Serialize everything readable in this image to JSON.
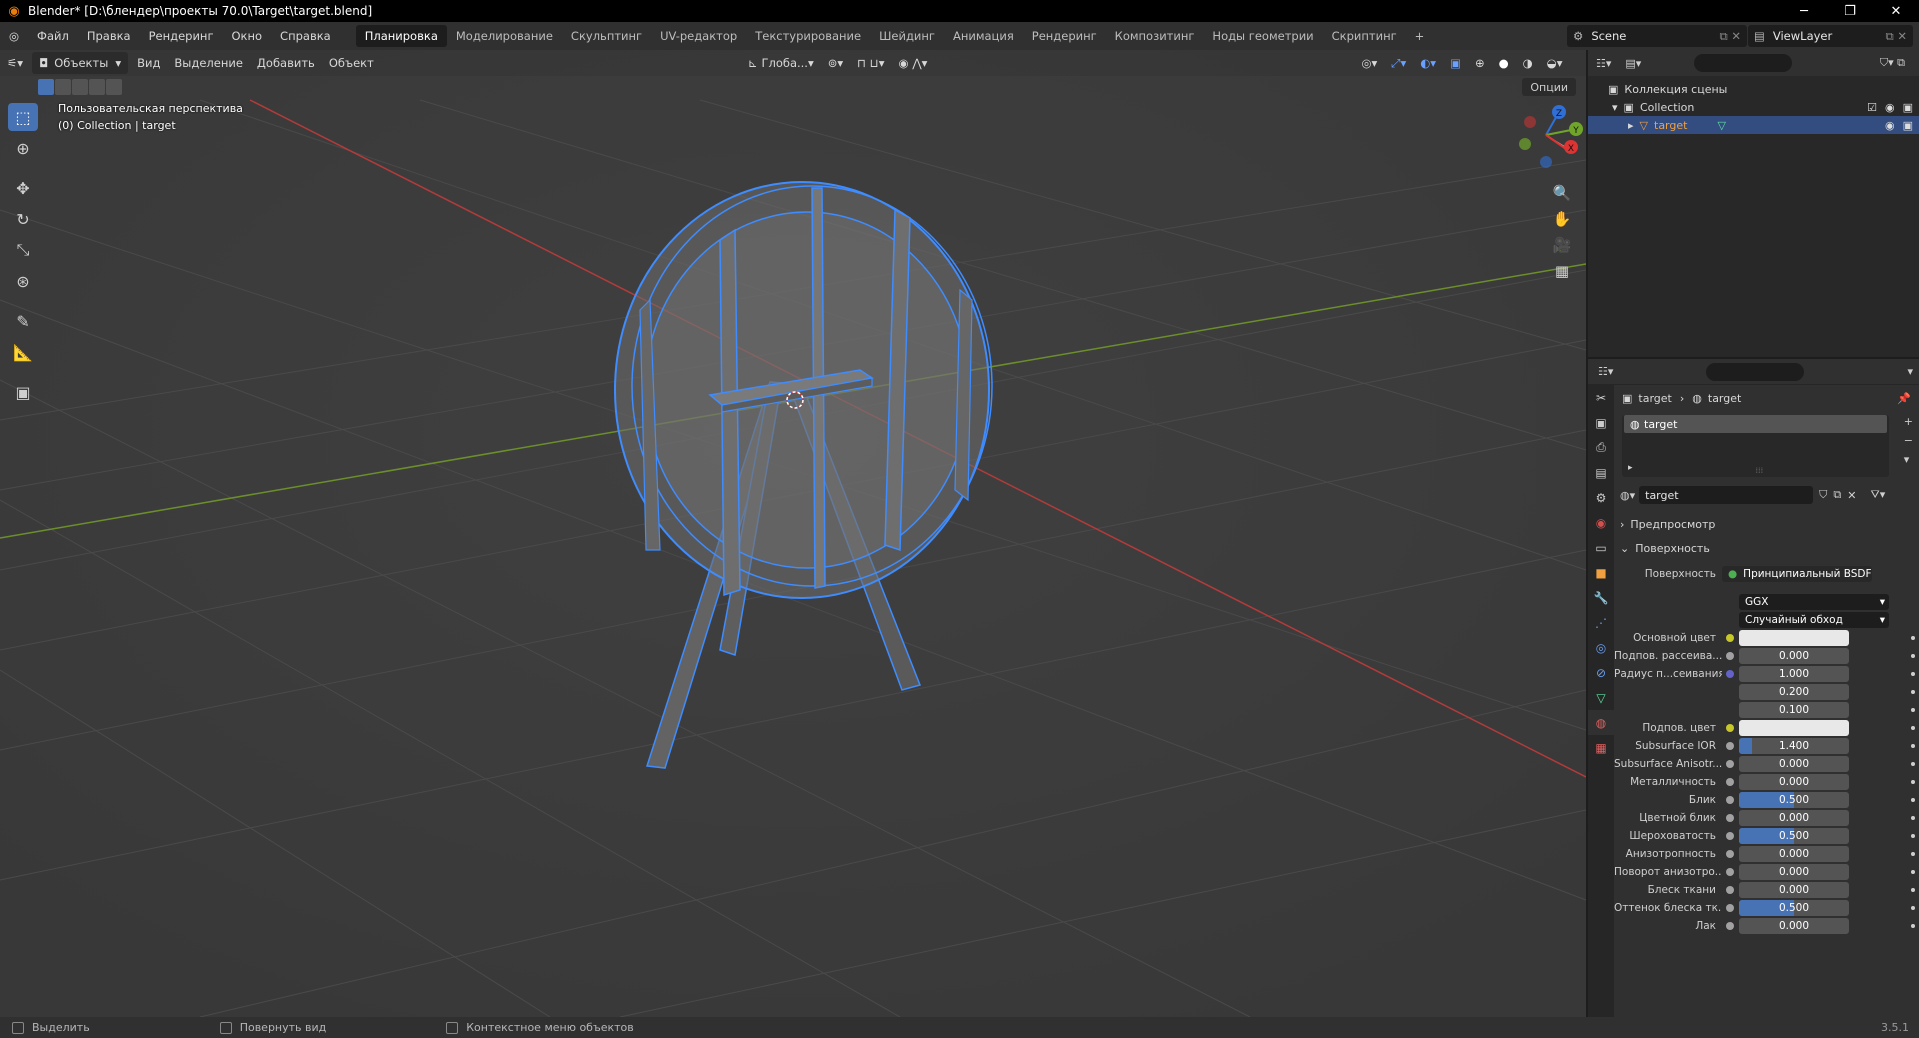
{
  "window": {
    "title": "Blender* [D:\\блендер\\проекты 70.0\\Target\\target.blend]"
  },
  "menu": [
    "Файл",
    "Правка",
    "Рендеринг",
    "Окно",
    "Справка"
  ],
  "workspaces": [
    "Планировка",
    "Моделирование",
    "Скульптинг",
    "UV-редактор",
    "Текстурирование",
    "Шейдинг",
    "Анимация",
    "Рендеринг",
    "Композитинг",
    "Ноды геометрии",
    "Скриптинг"
  ],
  "workspace_add": "+",
  "scene_name": "Scene",
  "view_layer": "ViewLayer",
  "viewport": {
    "mode": "Объекты",
    "menus": [
      "Вид",
      "Выделение",
      "Добавить",
      "Объект"
    ],
    "orientation": "Глоба...",
    "options": "Опции",
    "perspective_label": "Пользовательская перспектива",
    "collection_label": "(0) Collection | target",
    "gizmo_axes": [
      "X",
      "Y",
      "Z"
    ]
  },
  "outliner": {
    "scene_collection": "Коллекция сцены",
    "collection": "Collection",
    "object": "target"
  },
  "properties": {
    "breadcrumb_object": "target",
    "breadcrumb_material": "target",
    "slot": "target",
    "material_name": "target",
    "panels": {
      "preview": "Предпросмотр",
      "surface": "Поверхность"
    },
    "surface_label": "Поверхность",
    "surface_shader": "Принципиальный BSDF",
    "distribution": "GGX",
    "subsurface_method": "Случайный обход",
    "rows": [
      {
        "label": "Основной цвет",
        "value": "",
        "type": "color",
        "dot": "yellow"
      },
      {
        "label": "Подпов. рассеива...",
        "value": "0.000",
        "type": "num",
        "dot": "gray",
        "fill": 0
      },
      {
        "label": "Радиус п...сеивания",
        "value": "1.000",
        "type": "num",
        "dot": "blue",
        "fill": 0
      },
      {
        "label": "",
        "value": "0.200",
        "type": "num",
        "dot": "",
        "fill": 0
      },
      {
        "label": "",
        "value": "0.100",
        "type": "num",
        "dot": "",
        "fill": 0
      },
      {
        "label": "Подпов. цвет",
        "value": "",
        "type": "color",
        "dot": "yellow"
      },
      {
        "label": "Subsurface IOR",
        "value": "1.400",
        "type": "num",
        "dot": "gray",
        "fill": 0.12
      },
      {
        "label": "Subsurface Anisotr...",
        "value": "0.000",
        "type": "num",
        "dot": "gray",
        "fill": 0
      },
      {
        "label": "Металличность",
        "value": "0.000",
        "type": "num",
        "dot": "gray",
        "fill": 0
      },
      {
        "label": "Блик",
        "value": "0.500",
        "type": "num",
        "dot": "gray",
        "fill": 0.5
      },
      {
        "label": "Цветной блик",
        "value": "0.000",
        "type": "num",
        "dot": "gray",
        "fill": 0
      },
      {
        "label": "Шероховатость",
        "value": "0.500",
        "type": "num",
        "dot": "gray",
        "fill": 0.5
      },
      {
        "label": "Анизотропность",
        "value": "0.000",
        "type": "num",
        "dot": "gray",
        "fill": 0
      },
      {
        "label": "Поворот анизотро...",
        "value": "0.000",
        "type": "num",
        "dot": "gray",
        "fill": 0
      },
      {
        "label": "Блеск ткани",
        "value": "0.000",
        "type": "num",
        "dot": "gray",
        "fill": 0
      },
      {
        "label": "Оттенок блеска тк...",
        "value": "0.500",
        "type": "num",
        "dot": "gray",
        "fill": 0.5
      },
      {
        "label": "Лак",
        "value": "0.000",
        "type": "num",
        "dot": "gray",
        "fill": 0
      }
    ]
  },
  "status": {
    "select": "Выделить",
    "rotate": "Повернуть вид",
    "context": "Контекстное меню объектов",
    "version": "3.5.1"
  },
  "colors": {
    "accent": "#4772b3",
    "selection_outline": "#3f8cff",
    "x_axis": "#b23b3b",
    "y_axis": "#6c8f2b",
    "blender_orange": "#e87d0d"
  }
}
